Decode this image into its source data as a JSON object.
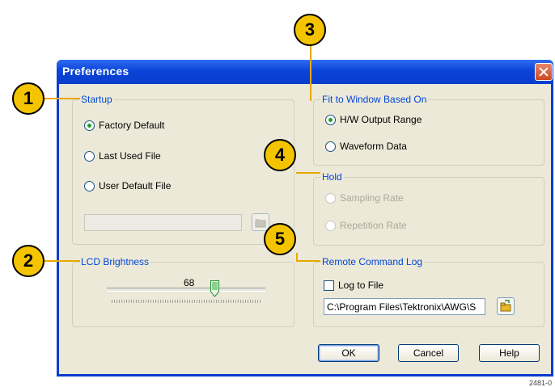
{
  "dialog": {
    "title": "Preferences"
  },
  "startup": {
    "legend": "Startup",
    "options": [
      "Factory Default",
      "Last Used File",
      "User Default File"
    ],
    "selected": "Factory Default",
    "file_path": ""
  },
  "lcd": {
    "legend": "LCD Brightness",
    "value": "68"
  },
  "fit": {
    "legend": "Fit to Window Based On",
    "options": [
      "H/W Output Range",
      "Waveform Data"
    ],
    "selected": "H/W Output Range"
  },
  "hold": {
    "legend": "Hold",
    "options": [
      "Sampling Rate",
      "Repetition Rate"
    ]
  },
  "remote_log": {
    "legend": "Remote Command Log",
    "log_to_file_label": "Log to File",
    "log_to_file_checked": false,
    "path": "C:\\Program Files\\Tektronix\\AWG\\S"
  },
  "buttons": {
    "ok": "OK",
    "cancel": "Cancel",
    "help": "Help"
  },
  "callouts": [
    "1",
    "2",
    "3",
    "4",
    "5"
  ],
  "figure_number": "2481-0",
  "colors": {
    "titlebar": "#0b44d8",
    "dialog_bg": "#ece9d8",
    "legend_text": "#0046d5",
    "callout_fill": "#f5c400"
  }
}
